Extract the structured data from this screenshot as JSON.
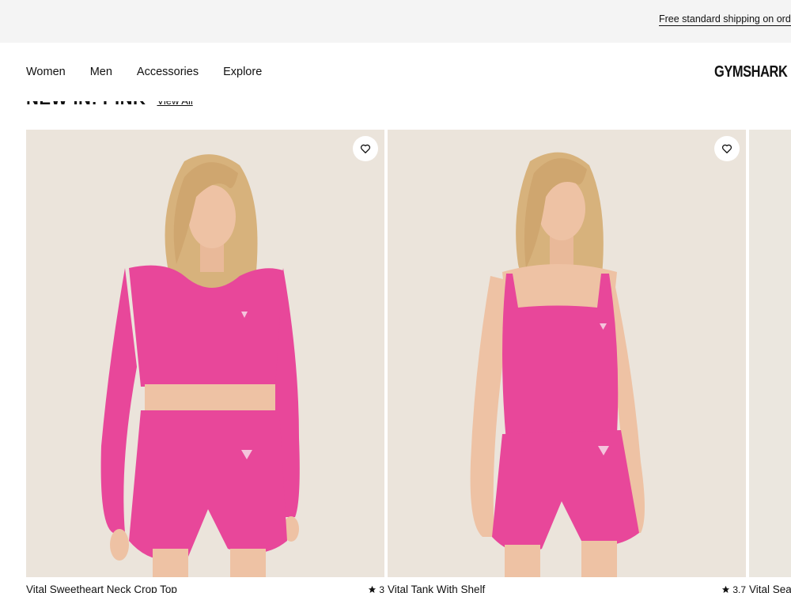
{
  "promo": {
    "text": "Free standard shipping on orders"
  },
  "nav": {
    "items": [
      "Women",
      "Men",
      "Accessories",
      "Explore"
    ],
    "logo": "GYMSHARK"
  },
  "section": {
    "title": "NEW IN: PINK",
    "view_all": "View All"
  },
  "colors": {
    "product_pink": "#e8479a",
    "background": "#ebe4db",
    "text": "#111111"
  },
  "products": [
    {
      "name": "Vital Sweetheart Neck Crop Top",
      "rating": "3",
      "star_icon": "star-icon"
    },
    {
      "name": "Vital Tank With Shelf",
      "rating": "3.7",
      "star_icon": "star-icon"
    },
    {
      "name": "Vital Sea"
    }
  ]
}
